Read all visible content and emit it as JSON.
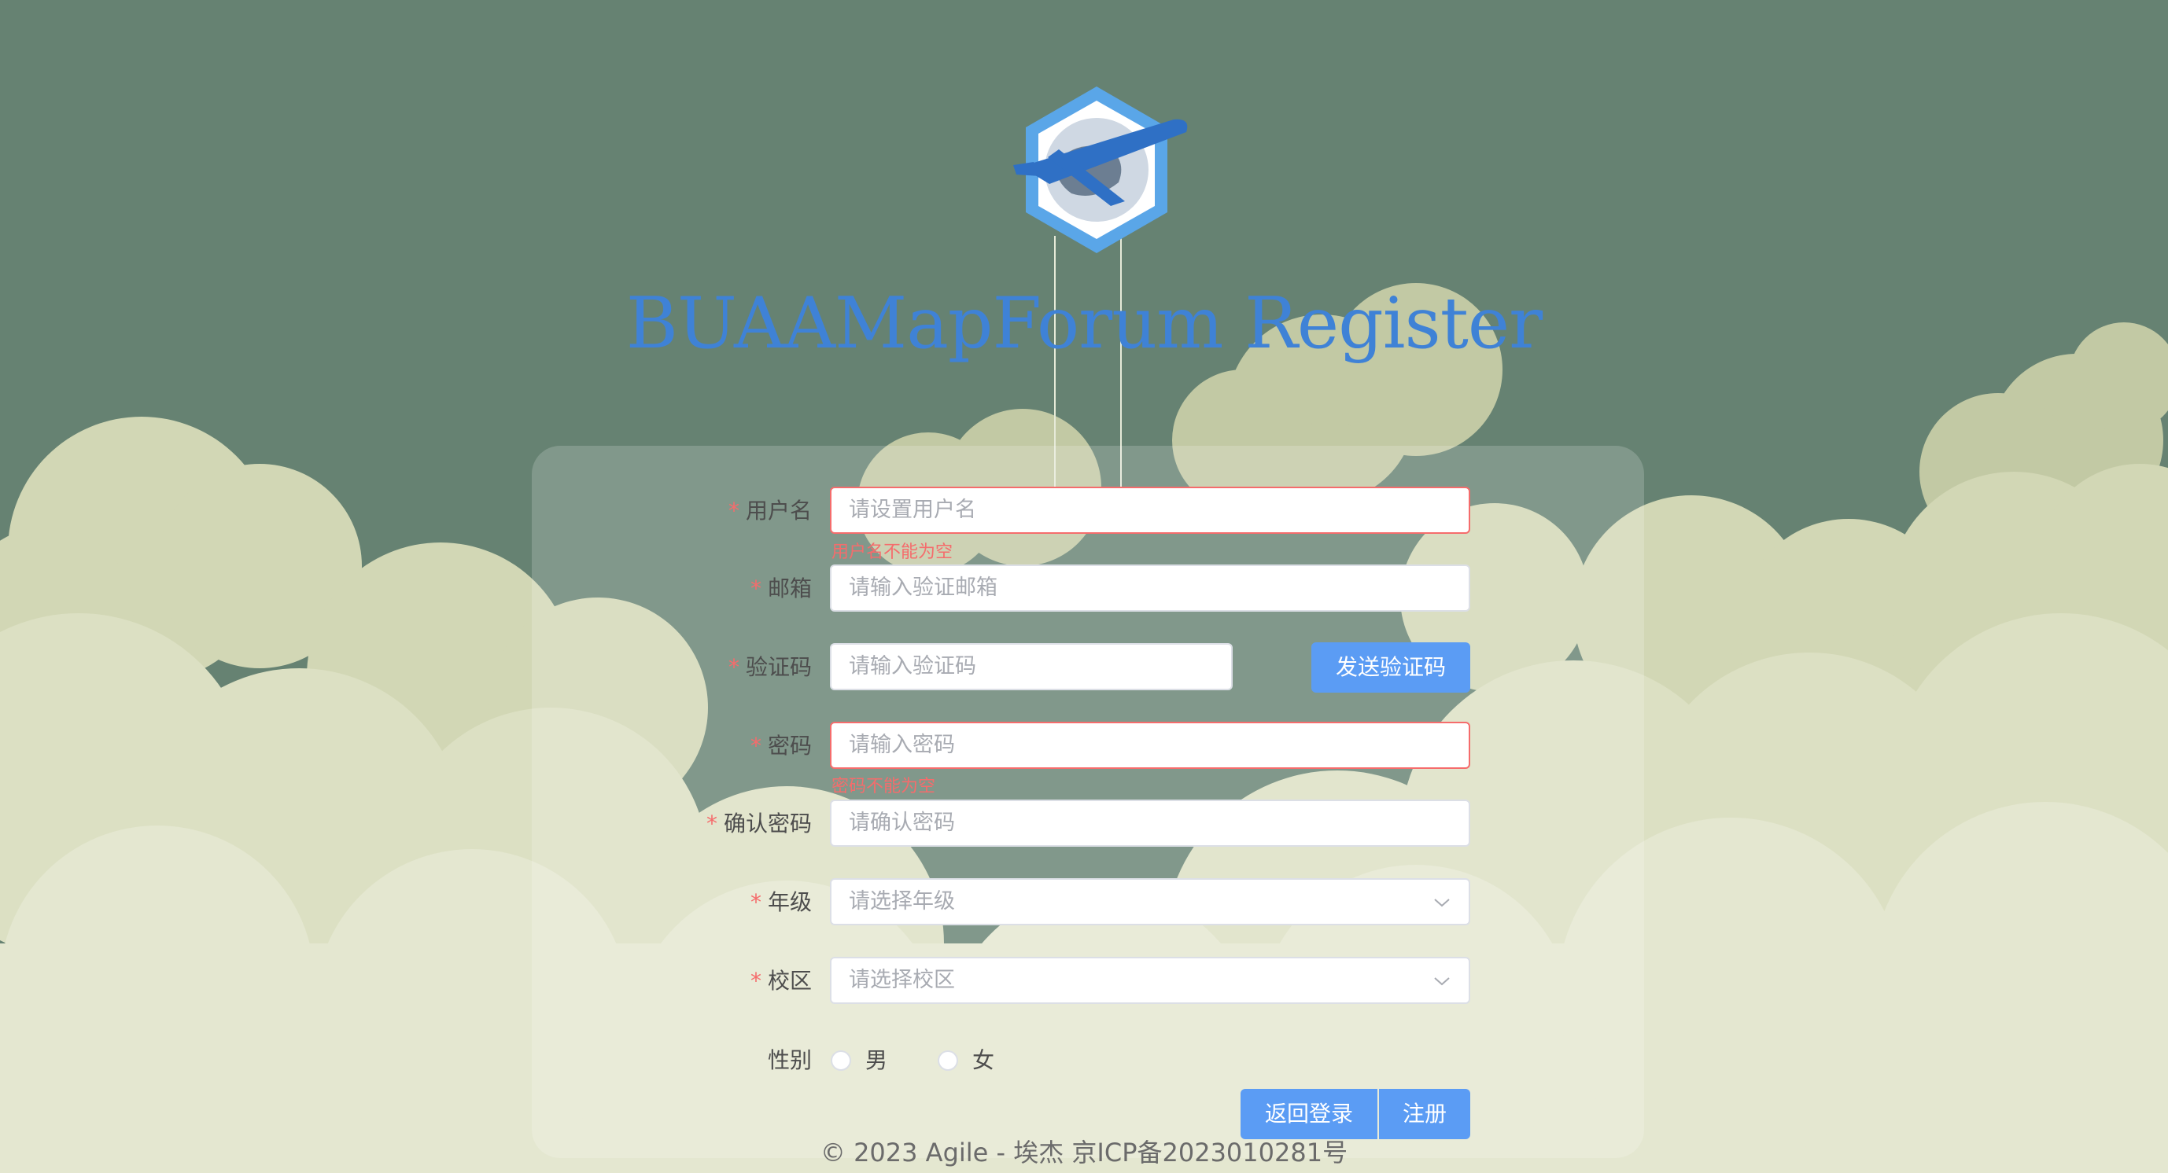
{
  "page": {
    "title": "BUAAMapForum Register"
  },
  "form": {
    "username": {
      "label": "用户名",
      "placeholder": "请设置用户名",
      "error": "用户名不能为空"
    },
    "email": {
      "label": "邮箱",
      "placeholder": "请输入验证邮箱"
    },
    "code": {
      "label": "验证码",
      "placeholder": "请输入验证码",
      "send_button": "发送验证码"
    },
    "password": {
      "label": "密码",
      "placeholder": "请输入密码",
      "error": "密码不能为空"
    },
    "confirm": {
      "label": "确认密码",
      "placeholder": "请确认密码"
    },
    "grade": {
      "label": "年级",
      "placeholder": "请选择年级"
    },
    "campus": {
      "label": "校区",
      "placeholder": "请选择校区"
    },
    "gender": {
      "label": "性别",
      "options": [
        "男",
        "女"
      ]
    },
    "required_mark": "*"
  },
  "actions": {
    "back_login": "返回登录",
    "register": "注册"
  },
  "footer": {
    "text": "© 2023 Agile - 埃杰 京ICP备2023010281号"
  },
  "colors": {
    "background": "#668272",
    "cloud": "#dfe3c6",
    "primary": "#5b9cf4",
    "error": "#f56c6c",
    "title": "#3f82d6"
  }
}
